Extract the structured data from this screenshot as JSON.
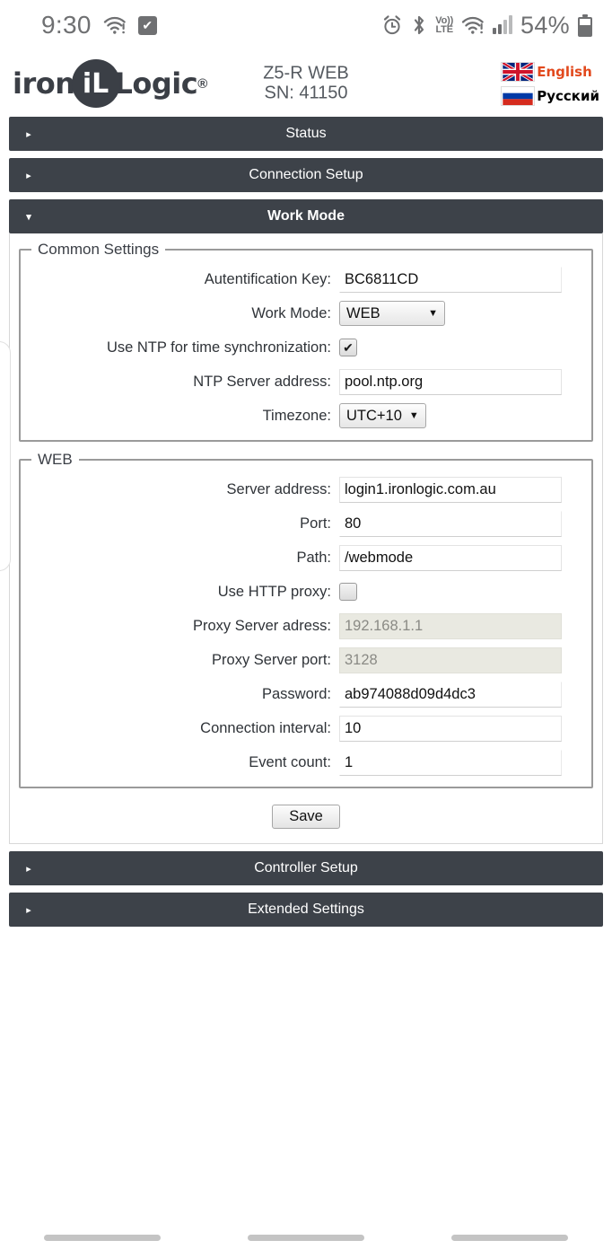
{
  "status_bar": {
    "time": "9:30",
    "wifi_icon": "wifi-exclamation-icon",
    "check_icon": "check-box-icon",
    "alarm_icon": "alarm-clock-icon",
    "bluetooth_icon": "bluetooth-icon",
    "volte_top": "Vo))",
    "volte_bottom": "LTE",
    "wifi_icon_2": "wifi-exclamation-icon",
    "signal_icon": "cellular-signal-icon",
    "battery_percent": "54%",
    "battery_icon": "battery-icon"
  },
  "header": {
    "logo_pre": "iron",
    "logo_badge": "iL",
    "logo_post": "Logic",
    "logo_reg": "®",
    "device_model": "Z5-R WEB",
    "device_sn": "SN: 41150",
    "languages": [
      {
        "label": "English",
        "flag": "uk-flag-icon",
        "active": true
      },
      {
        "label": "Русский",
        "flag": "russia-flag-icon",
        "active": false
      }
    ],
    "accent_color": "#e2491d"
  },
  "accordion": {
    "collapsed_arrow": "▸",
    "expanded_arrow": "▾",
    "sections": [
      {
        "title": "Status",
        "open": false
      },
      {
        "title": "Connection Setup",
        "open": false
      },
      {
        "title": "Work Mode",
        "open": true
      },
      {
        "title": "Controller Setup",
        "open": false
      },
      {
        "title": "Extended Settings",
        "open": false
      }
    ]
  },
  "work_mode": {
    "common": {
      "legend": "Common Settings",
      "auth_key": {
        "label": "Autentification Key:",
        "value": "BC6811CD"
      },
      "work_mode": {
        "label": "Work Mode:",
        "value": "WEB",
        "caret": "▼"
      },
      "use_ntp": {
        "label": "Use NTP for time synchronization:",
        "checked": true,
        "check_glyph": "✔"
      },
      "ntp_server": {
        "label": "NTP Server address:",
        "value": "pool.ntp.org"
      },
      "timezone": {
        "label": "Timezone:",
        "value": "UTC+10",
        "caret": "▼"
      }
    },
    "web": {
      "legend": "WEB",
      "server_address": {
        "label": "Server address:",
        "value": "login1.ironlogic.com.au"
      },
      "port": {
        "label": "Port:",
        "value": "80"
      },
      "path": {
        "label": "Path:",
        "value": "/webmode"
      },
      "use_proxy": {
        "label": "Use HTTP proxy:",
        "checked": false,
        "check_glyph": ""
      },
      "proxy_address": {
        "label": "Proxy Server adress:",
        "value": "192.168.1.1",
        "disabled": true
      },
      "proxy_port": {
        "label": "Proxy Server port:",
        "value": "3128",
        "disabled": true
      },
      "password": {
        "label": "Password:",
        "value": "ab974088d09d4dc3"
      },
      "connection_interval": {
        "label": "Connection interval:",
        "value": "10"
      },
      "event_count": {
        "label": "Event count:",
        "value": "1"
      }
    },
    "save_label": "Save"
  },
  "navbar": {
    "pills": [
      "recents-pill",
      "home-pill",
      "back-pill"
    ]
  }
}
